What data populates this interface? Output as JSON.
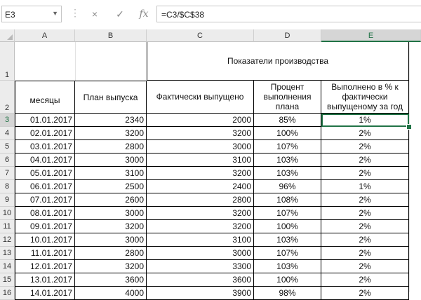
{
  "formula_bar": {
    "name_box": "E3",
    "formula": "=C3/$C$38",
    "cancel_icon": "×",
    "confirm_icon": "✓",
    "fx_icon": "fx"
  },
  "columns": [
    "A",
    "B",
    "C",
    "D",
    "E"
  ],
  "header": {
    "merged_title": "Показатели производства",
    "col_a": "месяцы",
    "col_b": "План выпуска",
    "col_c": "Фактически выпущено",
    "col_d": "Процент выполнения плана",
    "col_e": "Выполнено в % к фактически выпущеному за год"
  },
  "rows": [
    {
      "n": "3",
      "date": "01.01.2017",
      "plan": "2340",
      "fact": "2000",
      "pct": "85%",
      "share": "1%"
    },
    {
      "n": "4",
      "date": "02.01.2017",
      "plan": "3200",
      "fact": "3200",
      "pct": "100%",
      "share": "2%"
    },
    {
      "n": "5",
      "date": "03.01.2017",
      "plan": "2800",
      "fact": "3000",
      "pct": "107%",
      "share": "2%"
    },
    {
      "n": "6",
      "date": "04.01.2017",
      "plan": "3000",
      "fact": "3100",
      "pct": "103%",
      "share": "2%"
    },
    {
      "n": "7",
      "date": "05.01.2017",
      "plan": "3100",
      "fact": "3200",
      "pct": "103%",
      "share": "2%"
    },
    {
      "n": "8",
      "date": "06.01.2017",
      "plan": "2500",
      "fact": "2400",
      "pct": "96%",
      "share": "1%"
    },
    {
      "n": "9",
      "date": "07.01.2017",
      "plan": "2600",
      "fact": "2800",
      "pct": "108%",
      "share": "2%"
    },
    {
      "n": "10",
      "date": "08.01.2017",
      "plan": "3000",
      "fact": "3200",
      "pct": "107%",
      "share": "2%"
    },
    {
      "n": "11",
      "date": "09.01.2017",
      "plan": "3200",
      "fact": "3200",
      "pct": "100%",
      "share": "2%"
    },
    {
      "n": "12",
      "date": "10.01.2017",
      "plan": "3000",
      "fact": "3100",
      "pct": "103%",
      "share": "2%"
    },
    {
      "n": "13",
      "date": "11.01.2017",
      "plan": "2800",
      "fact": "3000",
      "pct": "107%",
      "share": "2%"
    },
    {
      "n": "14",
      "date": "12.01.2017",
      "plan": "3200",
      "fact": "3300",
      "pct": "103%",
      "share": "2%"
    },
    {
      "n": "15",
      "date": "13.01.2017",
      "plan": "3600",
      "fact": "3600",
      "pct": "100%",
      "share": "2%"
    },
    {
      "n": "16",
      "date": "14.01.2017",
      "plan": "4000",
      "fact": "3900",
      "pct": "98%",
      "share": "2%"
    }
  ],
  "colors": {
    "selection": "#217346",
    "header_bg": "#ececec"
  }
}
